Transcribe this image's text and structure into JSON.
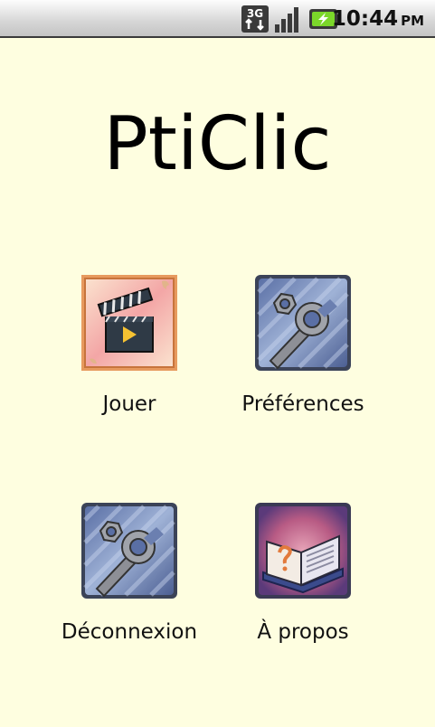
{
  "status_bar": {
    "network_type": "3G",
    "network_icon": "network-3g-icon",
    "signal_icon": "signal-bars-icon",
    "battery_icon": "battery-charging-icon",
    "time": "10:44",
    "ampm": "PM"
  },
  "app": {
    "title": "PtiClic"
  },
  "menu": [
    {
      "label": "Jouer",
      "icon": "clapperboard-icon"
    },
    {
      "label": "Préférences",
      "icon": "wrench-icon"
    },
    {
      "label": "Déconnexion",
      "icon": "wrench-icon"
    },
    {
      "label": "À propos",
      "icon": "book-icon"
    }
  ],
  "colors": {
    "background": "#fefee0",
    "status_bar": "#d6d6d6",
    "text": "#000000"
  }
}
